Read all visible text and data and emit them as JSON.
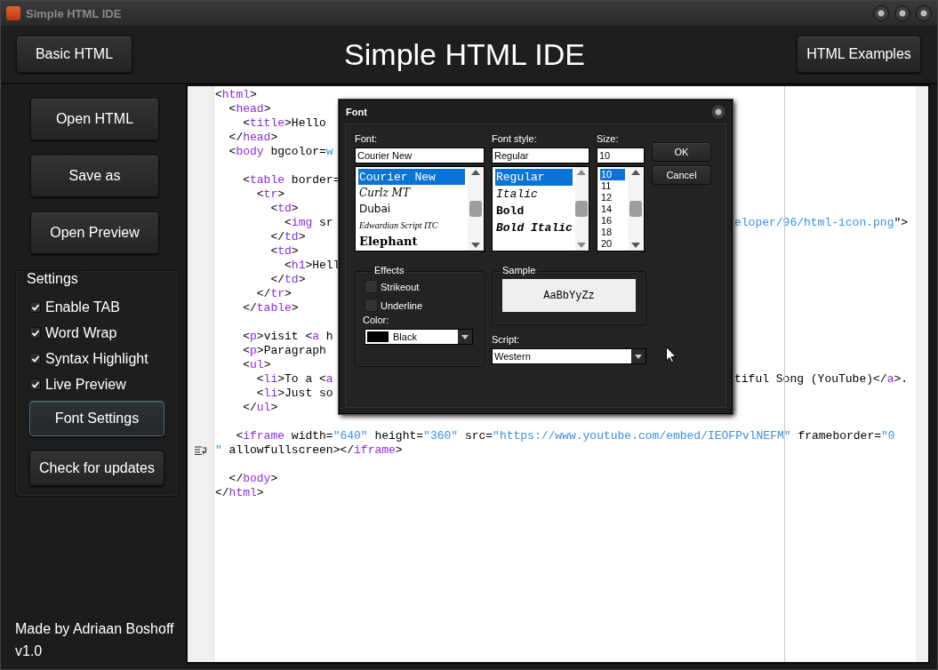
{
  "window": {
    "title": "Simple HTML IDE"
  },
  "header": {
    "left_button": "Basic HTML",
    "title": "Simple HTML IDE",
    "right_button": "HTML Examples"
  },
  "sidebar": {
    "buttons": [
      "Open HTML",
      "Save as",
      "Open Preview"
    ],
    "settings": {
      "title": "Settings",
      "options": [
        {
          "label": "Enable TAB",
          "checked": true
        },
        {
          "label": "Word Wrap",
          "checked": true
        },
        {
          "label": "Syntax Highlight",
          "checked": true
        },
        {
          "label": "Live Preview",
          "checked": true
        }
      ],
      "buttons": [
        {
          "label": "Font Settings",
          "selected": true
        },
        {
          "label": "Check for updates",
          "selected": false
        }
      ]
    },
    "credit": "Made by Adriaan Boshoff",
    "version": "v1.0"
  },
  "editor": {
    "lines": [
      {
        "kind": "code",
        "left": [
          {
            "kind": "plain",
            "text": "<"
          },
          {
            "kind": "tag",
            "text": "html"
          },
          {
            "kind": "plain",
            "text": ">"
          }
        ]
      },
      {
        "kind": "code",
        "left": [
          {
            "kind": "plain",
            "text": "  <"
          },
          {
            "kind": "tag",
            "text": "head"
          },
          {
            "kind": "plain",
            "text": ">"
          }
        ]
      },
      {
        "kind": "code",
        "left": [
          {
            "kind": "plain",
            "text": "    <"
          },
          {
            "kind": "tag",
            "text": "title"
          },
          {
            "kind": "plain",
            "text": ">Hello"
          }
        ]
      },
      {
        "kind": "code",
        "left": [
          {
            "kind": "plain",
            "text": "  </"
          },
          {
            "kind": "tag",
            "text": "head"
          },
          {
            "kind": "plain",
            "text": ">"
          }
        ]
      },
      {
        "kind": "code",
        "left": [
          {
            "kind": "plain",
            "text": "  <"
          },
          {
            "kind": "tag",
            "text": "body"
          },
          {
            "kind": "plain",
            "text": " bgcolor="
          },
          {
            "kind": "string",
            "text": "w"
          }
        ]
      },
      {
        "kind": "blank"
      },
      {
        "kind": "code",
        "left": [
          {
            "kind": "plain",
            "text": "    <"
          },
          {
            "kind": "tag",
            "text": "table"
          },
          {
            "kind": "plain",
            "text": " border="
          }
        ]
      },
      {
        "kind": "code",
        "left": [
          {
            "kind": "plain",
            "text": "      <"
          },
          {
            "kind": "tag",
            "text": "tr"
          },
          {
            "kind": "plain",
            "text": ">"
          }
        ]
      },
      {
        "kind": "code",
        "left": [
          {
            "kind": "plain",
            "text": "        <"
          },
          {
            "kind": "tag",
            "text": "td"
          },
          {
            "kind": "plain",
            "text": ">"
          }
        ]
      },
      {
        "kind": "code",
        "left": [
          {
            "kind": "plain",
            "text": "          <"
          },
          {
            "kind": "tag",
            "text": "img"
          },
          {
            "kind": "plain",
            "text": " sr"
          }
        ],
        "right": [
          {
            "kind": "string",
            "text": "eloper/96/html-icon.png"
          },
          {
            "kind": "plain",
            "text": "\">"
          }
        ]
      },
      {
        "kind": "code",
        "left": [
          {
            "kind": "plain",
            "text": "        </"
          },
          {
            "kind": "tag",
            "text": "td"
          },
          {
            "kind": "plain",
            "text": ">"
          }
        ]
      },
      {
        "kind": "code",
        "left": [
          {
            "kind": "plain",
            "text": "        <"
          },
          {
            "kind": "tag",
            "text": "td"
          },
          {
            "kind": "plain",
            "text": ">"
          }
        ]
      },
      {
        "kind": "code",
        "left": [
          {
            "kind": "plain",
            "text": "          <"
          },
          {
            "kind": "tag",
            "text": "h1"
          },
          {
            "kind": "plain",
            "text": ">Hell"
          }
        ]
      },
      {
        "kind": "code",
        "left": [
          {
            "kind": "plain",
            "text": "        </"
          },
          {
            "kind": "tag",
            "text": "td"
          },
          {
            "kind": "plain",
            "text": ">"
          }
        ]
      },
      {
        "kind": "code",
        "left": [
          {
            "kind": "plain",
            "text": "      </"
          },
          {
            "kind": "tag",
            "text": "tr"
          },
          {
            "kind": "plain",
            "text": ">"
          }
        ]
      },
      {
        "kind": "code",
        "left": [
          {
            "kind": "plain",
            "text": "    </"
          },
          {
            "kind": "tag",
            "text": "table"
          },
          {
            "kind": "plain",
            "text": ">"
          }
        ]
      },
      {
        "kind": "blank"
      },
      {
        "kind": "code",
        "left": [
          {
            "kind": "plain",
            "text": "    <"
          },
          {
            "kind": "tag",
            "text": "p"
          },
          {
            "kind": "plain",
            "text": ">visit <"
          },
          {
            "kind": "tag",
            "text": "a"
          },
          {
            "kind": "plain",
            "text": " h"
          }
        ]
      },
      {
        "kind": "code",
        "left": [
          {
            "kind": "plain",
            "text": "    <"
          },
          {
            "kind": "tag",
            "text": "p"
          },
          {
            "kind": "plain",
            "text": ">Paragraph"
          }
        ]
      },
      {
        "kind": "code",
        "left": [
          {
            "kind": "plain",
            "text": "    <"
          },
          {
            "kind": "tag",
            "text": "ul"
          },
          {
            "kind": "plain",
            "text": ">"
          }
        ]
      },
      {
        "kind": "code",
        "left": [
          {
            "kind": "plain",
            "text": "      <"
          },
          {
            "kind": "tag",
            "text": "li"
          },
          {
            "kind": "plain",
            "text": ">To a <"
          },
          {
            "kind": "tag",
            "text": "a"
          }
        ],
        "right": [
          {
            "kind": "plain",
            "text": "tiful Song (YouTube)</"
          },
          {
            "kind": "tag",
            "text": "a"
          },
          {
            "kind": "plain",
            "text": ">."
          }
        ]
      },
      {
        "kind": "code",
        "left": [
          {
            "kind": "plain",
            "text": "      <"
          },
          {
            "kind": "tag",
            "text": "li"
          },
          {
            "kind": "plain",
            "text": ">Just so"
          }
        ]
      },
      {
        "kind": "code",
        "left": [
          {
            "kind": "plain",
            "text": "    </"
          },
          {
            "kind": "tag",
            "text": "ul"
          },
          {
            "kind": "plain",
            "text": ">"
          }
        ]
      },
      {
        "kind": "blank"
      },
      {
        "kind": "code",
        "left": [
          {
            "kind": "plain",
            "text": "   <"
          },
          {
            "kind": "tag",
            "text": "iframe"
          },
          {
            "kind": "plain",
            "text": " width="
          },
          {
            "kind": "string",
            "text": "\"640\""
          },
          {
            "kind": "plain",
            "text": " height="
          },
          {
            "kind": "string",
            "text": "\"360\""
          },
          {
            "kind": "plain",
            "text": " src="
          },
          {
            "kind": "string",
            "text": "\"https://www.youtube.com/embed/IEOFPvlNEFM\""
          },
          {
            "kind": "plain",
            "text": " frameborder="
          },
          {
            "kind": "string",
            "text": "\"0"
          }
        ]
      },
      {
        "kind": "continuation",
        "left": [
          {
            "kind": "string",
            "text": "\""
          },
          {
            "kind": "plain",
            "text": " allowfullscreen></"
          },
          {
            "kind": "tag",
            "text": "iframe"
          },
          {
            "kind": "plain",
            "text": ">"
          }
        ]
      },
      {
        "kind": "blank"
      },
      {
        "kind": "code",
        "left": [
          {
            "kind": "plain",
            "text": "  </"
          },
          {
            "kind": "tag",
            "text": "body"
          },
          {
            "kind": "plain",
            "text": ">"
          }
        ]
      },
      {
        "kind": "code",
        "left": [
          {
            "kind": "plain",
            "text": "</"
          },
          {
            "kind": "tag",
            "text": "html"
          },
          {
            "kind": "plain",
            "text": ">"
          }
        ]
      }
    ]
  },
  "font_dialog": {
    "title": "Font",
    "font": {
      "label": "Font:",
      "value": "Courier New",
      "items": [
        {
          "text": "Courier New",
          "kind": "mono",
          "selected": true
        },
        {
          "text": "Curlz MT",
          "kind": "decorative",
          "selected": false
        },
        {
          "text": "Dubai",
          "kind": "sans",
          "selected": false
        },
        {
          "text": "Edwardian Script ITC",
          "kind": "script",
          "selected": false
        },
        {
          "text": "Elephant",
          "kind": "heavy",
          "selected": false
        }
      ]
    },
    "style": {
      "label": "Font style:",
      "value": "Regular",
      "items": [
        {
          "text": "Regular",
          "kind": "regular",
          "selected": true
        },
        {
          "text": "Italic",
          "kind": "italic",
          "selected": false
        },
        {
          "text": "Bold",
          "kind": "bold",
          "selected": false
        },
        {
          "text": "Bold Italic",
          "kind": "bolditalic",
          "selected": false
        }
      ]
    },
    "size": {
      "label": "Size:",
      "value": "10",
      "items": [
        {
          "text": "10",
          "selected": true
        },
        {
          "text": "11",
          "selected": false
        },
        {
          "text": "12",
          "selected": false
        },
        {
          "text": "14",
          "selected": false
        },
        {
          "text": "16",
          "selected": false
        },
        {
          "text": "18",
          "selected": false
        },
        {
          "text": "20",
          "selected": false
        }
      ]
    },
    "buttons": [
      "OK",
      "Cancel"
    ],
    "effects": {
      "title": "Effects",
      "options": [
        {
          "label": "Strikeout",
          "checked": false
        },
        {
          "label": "Underline",
          "checked": false
        }
      ],
      "color_label": "Color:",
      "color": {
        "name": "Black",
        "color": "#000000"
      }
    },
    "sample": {
      "title": "Sample",
      "text": "AaBbYyZz"
    },
    "script": {
      "label": "Script:",
      "value": "Western"
    }
  }
}
